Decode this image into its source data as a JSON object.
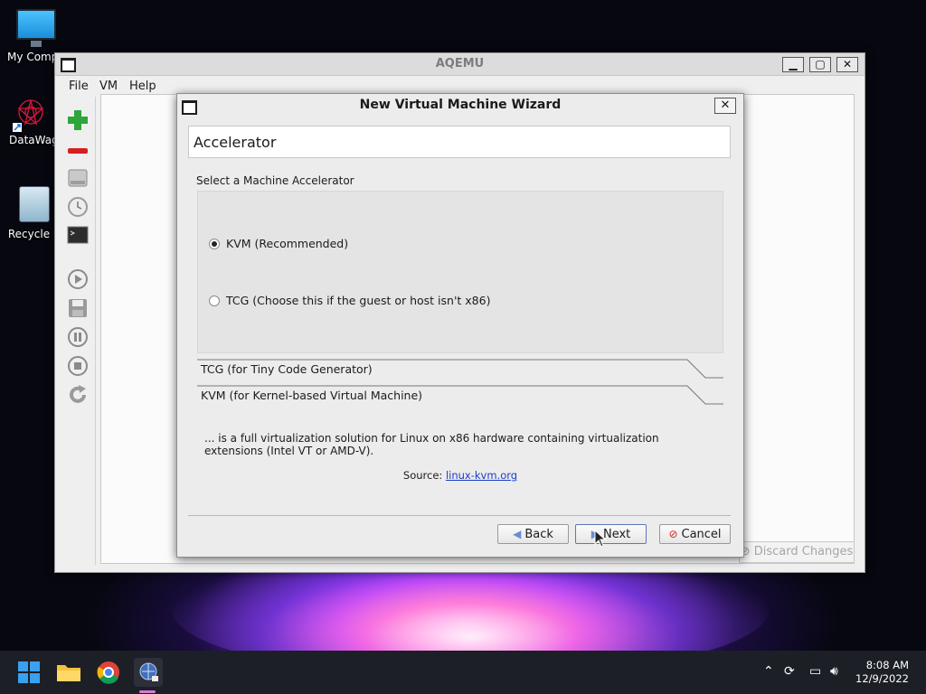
{
  "desktop": {
    "icons": [
      {
        "label": "My Compu",
        "icon": "computer-icon"
      },
      {
        "label": "DataWago",
        "icon": "datawagon-icon"
      },
      {
        "label": "Recycle B",
        "icon": "recycle-bin-icon"
      }
    ]
  },
  "main_window": {
    "title": "AQEMU",
    "menu": [
      "File",
      "VM",
      "Help"
    ],
    "toolbar_icons": [
      "add-vm-icon",
      "remove-vm-icon",
      "drive-icon",
      "clock-icon",
      "terminal-icon",
      "play-icon",
      "save-icon",
      "pause-icon",
      "stop-icon",
      "reload-icon"
    ],
    "discard_label": "Discard Changes"
  },
  "dialog": {
    "title": "New Virtual Machine Wizard",
    "page_title": "Accelerator",
    "section_label": "Select a Machine Accelerator",
    "options": [
      {
        "label": "KVM (Recommended)",
        "selected": true
      },
      {
        "label": "TCG (Choose this if the guest or host isn't x86)",
        "selected": false
      }
    ],
    "info_tabs": [
      "TCG (for Tiny Code Generator)",
      "KVM (for Kernel-based Virtual Machine)"
    ],
    "description": "... is a full virtualization solution for Linux on x86 hardware containing virtualization extensions (Intel VT or AMD-V).",
    "source_label": "Source:",
    "source_link": "linux-kvm.org",
    "buttons": {
      "back": "Back",
      "next": "Next",
      "cancel": "Cancel"
    }
  },
  "taskbar": {
    "apps": [
      "windows-start-icon",
      "file-explorer-icon",
      "chrome-icon",
      "aqemu-icon"
    ],
    "time": "8:08 AM",
    "date": "12/9/2022"
  },
  "colors": {
    "link": "#1a3cc4",
    "add_green": "#2da63b",
    "remove_red": "#d62020"
  }
}
